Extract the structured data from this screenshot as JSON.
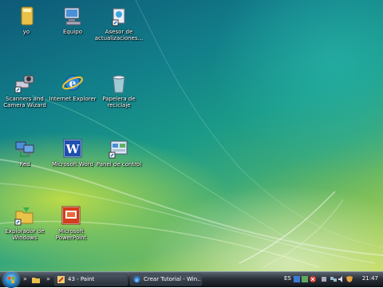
{
  "desktop": {
    "icons": [
      {
        "label": "yo"
      },
      {
        "label": "Equipo"
      },
      {
        "label": "Asesor de actualizaciones..."
      },
      {
        "label": "Scanners and Camera Wizard"
      },
      {
        "label": "Internet Explorer"
      },
      {
        "label": "Papelera de reciclaje"
      },
      {
        "label": "Red"
      },
      {
        "label": "Microsoft Word"
      },
      {
        "label": "Panel de control"
      },
      {
        "label": "Explorador de Windows"
      },
      {
        "label": "Microsoft PowerPoint"
      }
    ]
  },
  "taskbar": {
    "quicklaunch_chevron": "»",
    "tasks": [
      {
        "label": "43 - Paint"
      },
      {
        "label": "Crear Tutorial - Win..."
      }
    ],
    "language": "ES",
    "clock": "21:47"
  },
  "colors": {
    "taskbar": "#1b2128",
    "label_text": "#ffffff"
  }
}
